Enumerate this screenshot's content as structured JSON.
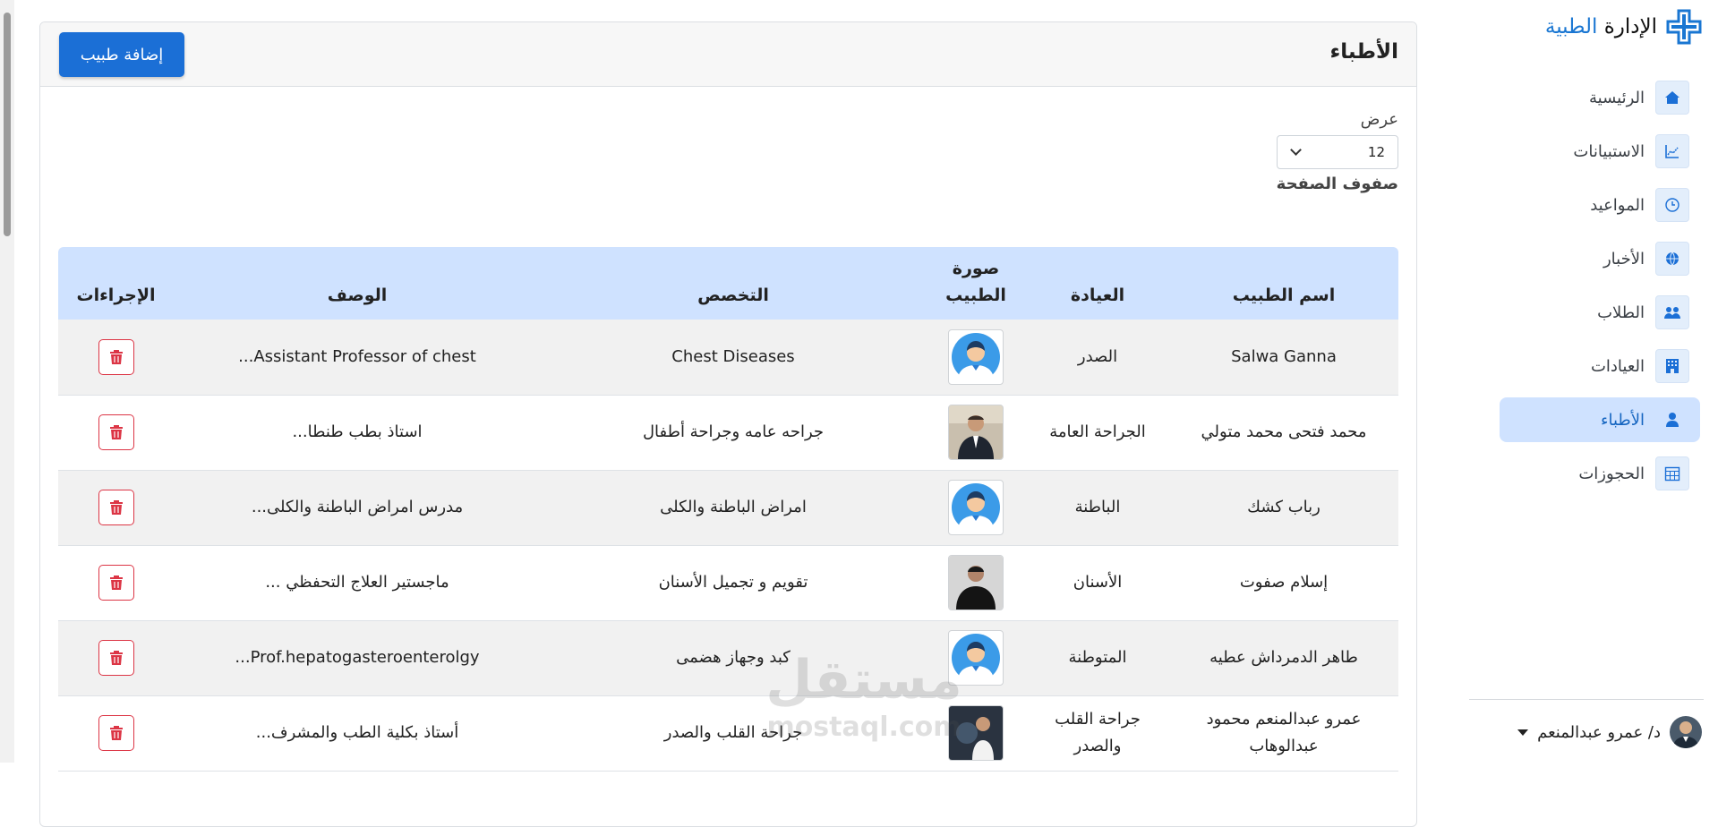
{
  "brand": {
    "part1": "الإدارة",
    "part2": "الطبية"
  },
  "sidebar": {
    "items": [
      {
        "label": "الرئيسية",
        "icon": "home-icon",
        "active": false
      },
      {
        "label": "الاستبيانات",
        "icon": "chart-icon",
        "active": false
      },
      {
        "label": "المواعيد",
        "icon": "clock-icon",
        "active": false
      },
      {
        "label": "الأخبار",
        "icon": "globe-icon",
        "active": false
      },
      {
        "label": "الطلاب",
        "icon": "students-icon",
        "active": false
      },
      {
        "label": "العيادات",
        "icon": "building-icon",
        "active": false
      },
      {
        "label": "الأطباء",
        "icon": "doctor-icon",
        "active": true
      },
      {
        "label": "الحجوزات",
        "icon": "calendar-icon",
        "active": false
      }
    ],
    "user": {
      "name": "د/ عمرو عبدالمنعم"
    }
  },
  "page": {
    "title": "الأطباء",
    "add_button": "إضافة طبيب",
    "page_size": {
      "label_top": "عرض",
      "value": "12",
      "label_bottom": "صفوف الصفحة"
    }
  },
  "table": {
    "headers": [
      "اسم الطبيب",
      "العيادة",
      "صورة الطبيب",
      "التخصص",
      "الوصف",
      "الإجراءات"
    ],
    "rows": [
      {
        "name": "Salwa Ganna",
        "clinic": "الصدر",
        "photo": "placeholder",
        "specialty": "Chest Diseases",
        "description": "Assistant Professor of chest..."
      },
      {
        "name": "محمد فتحى محمد متولي",
        "clinic": "الجراحة العامة",
        "photo": "man-suit",
        "specialty": "جراحه عامه وجراحة أطفال",
        "description": "استاذ بطب طنطا..."
      },
      {
        "name": "رباب كشك",
        "clinic": "الباطنة",
        "photo": "placeholder",
        "specialty": "امراض الباطنة والكلى",
        "description": "مدرس امراض الباطنة والكلى..."
      },
      {
        "name": "إسلام صفوت",
        "clinic": "الأسنان",
        "photo": "man-dark",
        "specialty": "تقويم و تجميل الأسنان",
        "description": "ماجستير العلاج التحفظي ..."
      },
      {
        "name": "طاهر الدمرداش عطيه",
        "clinic": "المتوطنة",
        "photo": "placeholder",
        "specialty": "كبد وجهاز هضمى",
        "description": "Prof.hepatogasteroenterolgy..."
      },
      {
        "name": "عمرو عبدالمنعم محمود عبدالوهاب",
        "clinic": "جراحة القلب والصدر",
        "photo": "man-lab",
        "specialty": "جراحة القلب والصدر",
        "description": "أستاذ بكلية الطب والمشرف..."
      }
    ]
  },
  "watermark": {
    "arabic": "مستقل",
    "latin": "mostaql.com"
  },
  "colors": {
    "primary": "#1b6fd6",
    "active_nav_bg": "#cfe2ff",
    "table_header_bg": "#cfe2ff",
    "danger": "#dc3545"
  }
}
